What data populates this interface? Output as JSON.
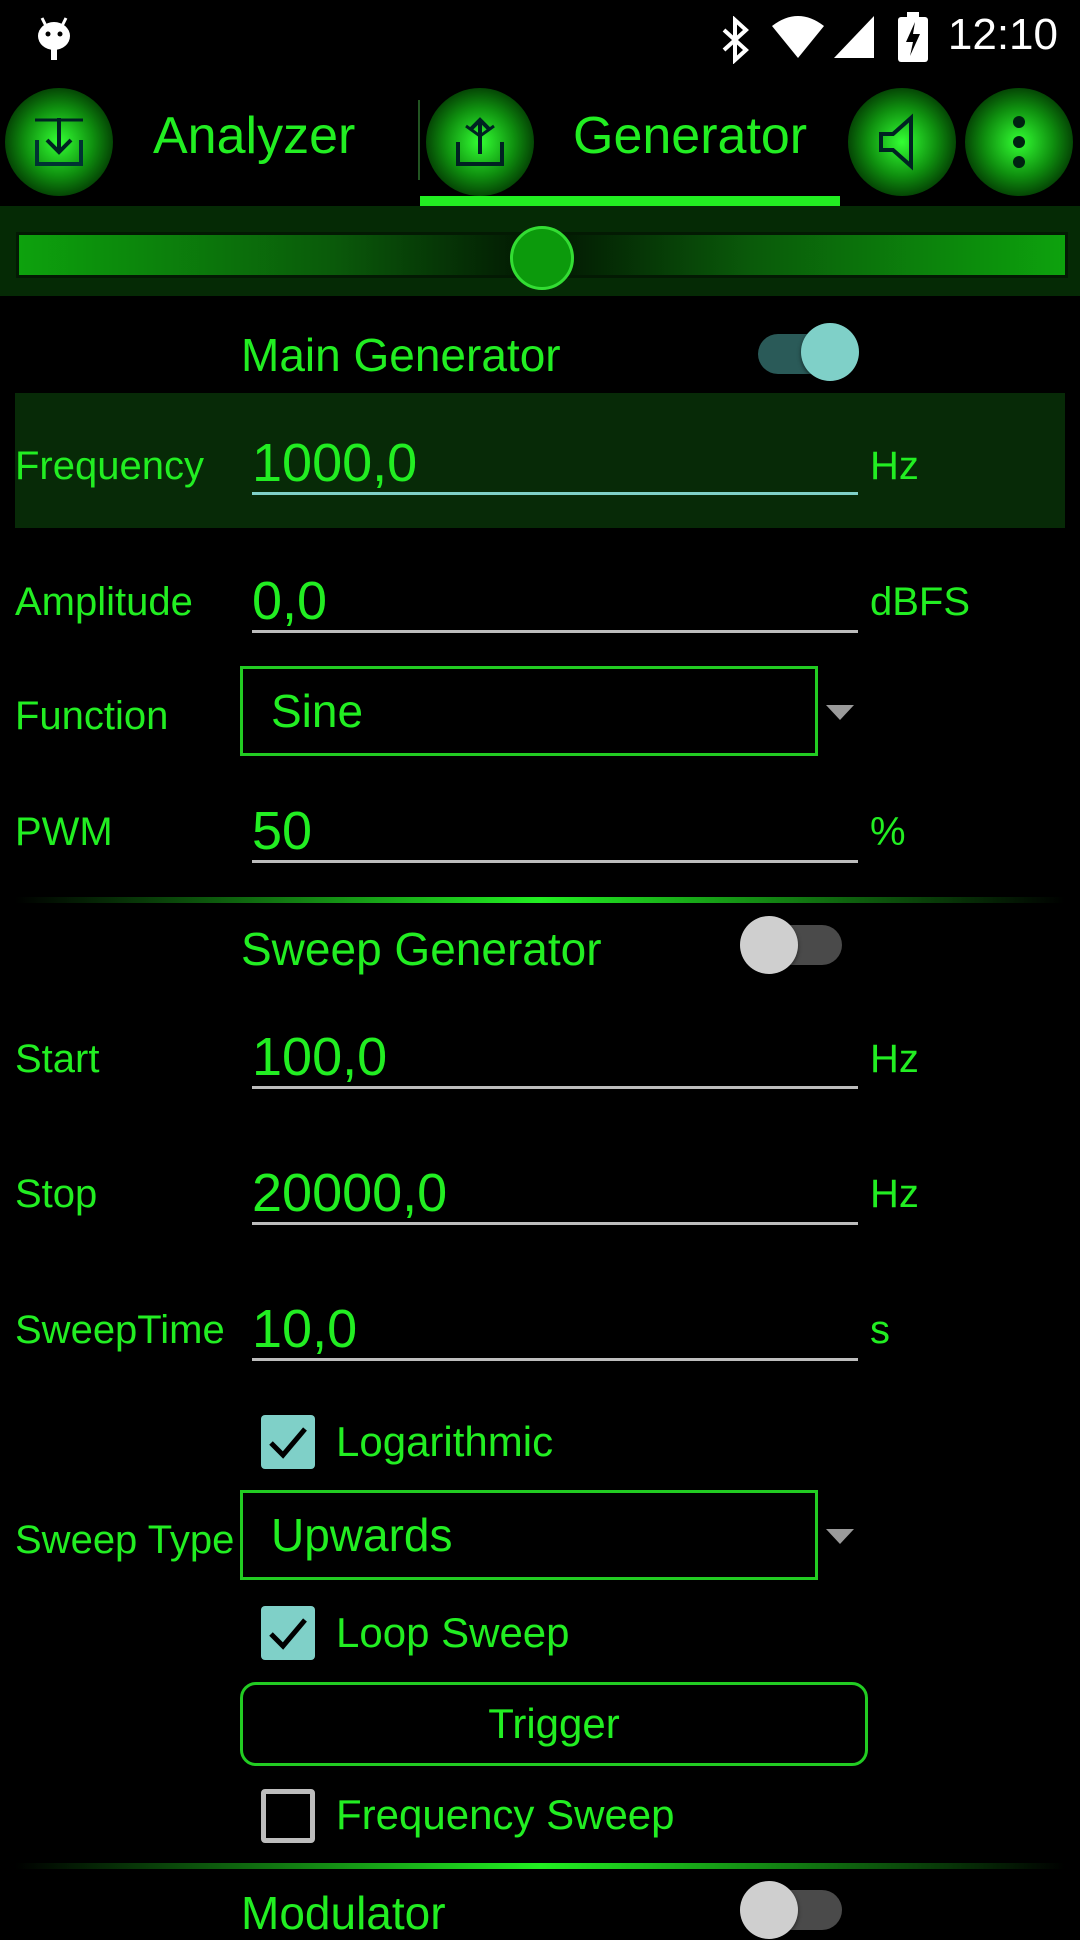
{
  "status_bar": {
    "time": "12:10"
  },
  "tabs": [
    {
      "label": "Analyzer",
      "icon": "import-icon"
    },
    {
      "label": "Generator",
      "icon": "share-icon",
      "selected": true
    }
  ],
  "actions": {
    "speaker_icon": "speaker-icon",
    "menu_icon": "overflow-menu-icon"
  },
  "level_slider": {
    "value_fraction": 0.5
  },
  "main_generator": {
    "title": "Main Generator",
    "enabled": true,
    "frequency": {
      "label": "Frequency",
      "value": "1000,0",
      "unit": "Hz"
    },
    "amplitude": {
      "label": "Amplitude",
      "value": "0,0",
      "unit": "dBFS"
    },
    "function": {
      "label": "Function",
      "selected": "Sine"
    },
    "pwm": {
      "label": "PWM",
      "value": "50",
      "unit": "%"
    }
  },
  "sweep_generator": {
    "title": "Sweep Generator",
    "enabled": false,
    "start": {
      "label": "Start",
      "value": "100,0",
      "unit": "Hz"
    },
    "stop": {
      "label": "Stop",
      "value": "20000,0",
      "unit": "Hz"
    },
    "sweep_time": {
      "label": "SweepTime",
      "value": "10,0",
      "unit": "s"
    },
    "logarithmic": {
      "label": "Logarithmic",
      "checked": true
    },
    "sweep_type": {
      "label": "Sweep Type",
      "selected": "Upwards"
    },
    "loop_sweep": {
      "label": "Loop Sweep",
      "checked": true
    },
    "trigger_label": "Trigger",
    "frequency_sweep": {
      "label": "Frequency Sweep",
      "checked": false
    }
  },
  "modulator": {
    "title": "Modulator",
    "enabled": false
  },
  "colors": {
    "accent": "#22ee22",
    "background": "#000000",
    "toggle_on": "#7fd0c8",
    "highlight_row": "#072a07"
  }
}
